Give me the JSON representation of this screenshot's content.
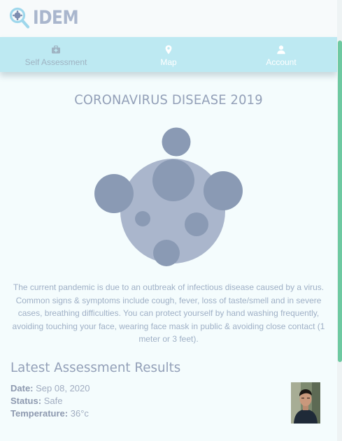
{
  "brand": {
    "name": "IDEM",
    "color": "#a9b6cd"
  },
  "nav": {
    "items": [
      {
        "label": "Self Assessment",
        "icon": "briefcase-medical-icon",
        "state": "muted"
      },
      {
        "label": "Map",
        "icon": "map-marker-icon",
        "state": "active"
      },
      {
        "label": "Account",
        "icon": "user-icon",
        "state": "active"
      }
    ],
    "background": "#bde9f2"
  },
  "main": {
    "title": "CORONAVIRUS DISEASE 2019",
    "illustration": "virus-illustration",
    "description": "The current pandemic is due to an outbreak of infectious disease caused by a virus. Common signs & symptoms include cough, fever, loss of taste/smell and in severe cases, breathing difficulties. You can protect yourself by hand washing frequently, avoiding touching your face, wearing face mask in public & avoiding close contact (1 meter or 3 feet)."
  },
  "results": {
    "title": "Latest Assessment Results",
    "date_label": "Date:",
    "date_value": "Sep 08, 2020",
    "status_label": "Status:",
    "status_value": "Safe",
    "temperature_label": "Temperature:",
    "temperature_value": "36°c",
    "avatar": "user-photo"
  },
  "colors": {
    "page_background": "#f4fcfd",
    "virus_body": "#aab6cc",
    "virus_spots": "#8a9ab4",
    "scrollbar": "#6ec9a1"
  }
}
